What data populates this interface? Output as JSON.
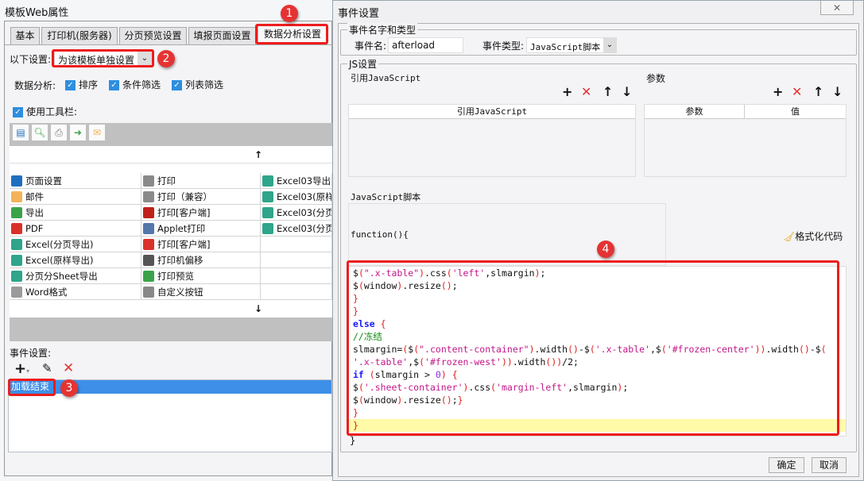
{
  "left_window": {
    "title": "模板Web属性",
    "tabs": [
      "基本",
      "打印机(服务器)",
      "分页预览设置",
      "填报页面设置",
      "数据分析设置"
    ],
    "active_tab": 4,
    "settings_label": "以下设置:",
    "settings_value": "为该模板单独设置",
    "analysis_label": "数据分析:",
    "analysis_options": [
      {
        "label": "排序",
        "checked": true
      },
      {
        "label": "条件筛选",
        "checked": true
      },
      {
        "label": "列表筛选",
        "checked": true
      }
    ],
    "use_toolbar": {
      "label": "使用工具栏:",
      "checked": true
    },
    "toolbar_icons": [
      "page-setup-icon",
      "print-preview-icon",
      "print-icon",
      "export-icon",
      "email-icon"
    ],
    "grid_columns": [
      [
        {
          "label": "页面设置",
          "icon": "page-setup-icon",
          "color": "#1f6fc0"
        },
        {
          "label": "邮件",
          "icon": "email-icon",
          "color": "#f3b35a"
        },
        {
          "label": "导出",
          "icon": "export-icon",
          "color": "#3aa34a"
        },
        {
          "label": "PDF",
          "icon": "pdf-icon",
          "color": "#d9322a"
        },
        {
          "label": "Excel(分页导出)",
          "icon": "excel-icon",
          "color": "#2fa58a"
        },
        {
          "label": "Excel(原样导出)",
          "icon": "excel-icon",
          "color": "#2fa58a"
        },
        {
          "label": "分页分Sheet导出",
          "icon": "excel-icon",
          "color": "#2fa58a"
        },
        {
          "label": "Word格式",
          "icon": "word-icon",
          "color": "#9a9a9a"
        }
      ],
      [
        {
          "label": "打印",
          "icon": "print-icon",
          "color": "#8a8a8a"
        },
        {
          "label": "打印（兼容）",
          "icon": "print-icon",
          "color": "#8a8a8a"
        },
        {
          "label": "打印[客户端]",
          "icon": "flash-print-icon",
          "color": "#c0201a"
        },
        {
          "label": "Applet打印",
          "icon": "java-icon",
          "color": "#5577aa"
        },
        {
          "label": "打印[客户端]",
          "icon": "pdf-print-icon",
          "color": "#d9322a"
        },
        {
          "label": "打印机偏移",
          "icon": "move-icon",
          "color": "#555555"
        },
        {
          "label": "打印预览",
          "icon": "print-preview-icon",
          "color": "#3aa34a"
        },
        {
          "label": "自定义按钮",
          "icon": "gear-icon",
          "color": "#888888"
        }
      ],
      [
        {
          "label": "Excel03导出",
          "icon": "excel-icon",
          "color": "#2fa58a"
        },
        {
          "label": "Excel03(原样",
          "icon": "excel-icon",
          "color": "#2fa58a"
        },
        {
          "label": "Excel03(分页",
          "icon": "excel-icon",
          "color": "#2fa58a"
        },
        {
          "label": "Excel03(分页",
          "icon": "excel-icon",
          "color": "#2fa58a"
        }
      ]
    ],
    "event_label": "事件设置:",
    "events": [
      "加载结束"
    ],
    "selected_color": "#3d8fe8"
  },
  "annotations": [
    "1",
    "2",
    "3",
    "4"
  ],
  "dialog": {
    "title": "事件设置",
    "name_type_group": "事件名字和类型",
    "event_name_label": "事件名:",
    "event_name_value": "afterload",
    "event_type_label": "事件类型:",
    "event_type_value": "JavaScript脚本",
    "js_group": "JS设置",
    "ref_js_label": "引用JavaScript",
    "ref_js_header": "引用JavaScript",
    "params_label": "参数",
    "params_headers": [
      "参数",
      "值"
    ],
    "script_label": "JavaScript脚本",
    "function_header": "function(){",
    "format_code": "格式化代码",
    "code_lines": [
      [
        [
          "$",
          "plain"
        ],
        [
          "(",
          "paren"
        ],
        [
          "\".x-table\"",
          "str"
        ],
        [
          ")",
          "paren"
        ],
        [
          ".css",
          "plain"
        ],
        [
          "(",
          "paren"
        ],
        [
          "'left'",
          "str"
        ],
        [
          ",slmargin",
          "plain"
        ],
        [
          ")",
          "paren"
        ],
        [
          ";",
          "plain"
        ]
      ],
      [
        [
          "$",
          "plain"
        ],
        [
          "(",
          "paren"
        ],
        [
          "window",
          "plain"
        ],
        [
          ")",
          "paren"
        ],
        [
          ".resize",
          "plain"
        ],
        [
          "()",
          "paren"
        ],
        [
          ";",
          "plain"
        ]
      ],
      [
        [
          "}",
          "paren"
        ]
      ],
      [
        [
          "}",
          "paren"
        ]
      ],
      [
        [
          "else ",
          "kw"
        ],
        [
          "{",
          "paren"
        ]
      ],
      [
        [
          "//冻结",
          "com"
        ]
      ],
      [
        [
          "slmargin=",
          "plain"
        ],
        [
          "(",
          "paren"
        ],
        [
          "$",
          "plain"
        ],
        [
          "(",
          "paren"
        ],
        [
          "\".content-container\"",
          "str"
        ],
        [
          ")",
          "paren"
        ],
        [
          ".width",
          "plain"
        ],
        [
          "()",
          "paren"
        ],
        [
          "-$",
          "plain"
        ],
        [
          "(",
          "paren"
        ],
        [
          "'.x-table'",
          "str"
        ],
        [
          ",$",
          "plain"
        ],
        [
          "(",
          "paren"
        ],
        [
          "'#frozen-center'",
          "str"
        ],
        [
          "))",
          "paren"
        ],
        [
          ".width",
          "plain"
        ],
        [
          "()",
          "paren"
        ],
        [
          "-$",
          "plain"
        ],
        [
          "(",
          "paren"
        ]
      ],
      [
        [
          "'.x-table'",
          "str"
        ],
        [
          ",$",
          "plain"
        ],
        [
          "(",
          "paren"
        ],
        [
          "'#frozen-west'",
          "str"
        ],
        [
          "))",
          "paren"
        ],
        [
          ".width",
          "plain"
        ],
        [
          "())",
          "paren"
        ],
        [
          "/2;",
          "plain"
        ]
      ],
      [
        [
          "if ",
          "kw"
        ],
        [
          "(",
          "paren"
        ],
        [
          "slmargin ",
          "plain"
        ],
        [
          "> ",
          "plain"
        ],
        [
          "0",
          "num"
        ],
        [
          ") ",
          "paren"
        ],
        [
          "{",
          "paren"
        ]
      ],
      [
        [
          "$",
          "plain"
        ],
        [
          "(",
          "paren"
        ],
        [
          "'.sheet-container'",
          "str"
        ],
        [
          ")",
          "paren"
        ],
        [
          ".css",
          "plain"
        ],
        [
          "(",
          "paren"
        ],
        [
          "'margin-left'",
          "str"
        ],
        [
          ",slmargin",
          "plain"
        ],
        [
          ")",
          "paren"
        ],
        [
          ";",
          "plain"
        ]
      ],
      [
        [
          "$",
          "plain"
        ],
        [
          "(",
          "paren"
        ],
        [
          "window",
          "plain"
        ],
        [
          ")",
          "paren"
        ],
        [
          ".resize",
          "plain"
        ],
        [
          "()",
          "paren"
        ],
        [
          ";",
          "plain"
        ],
        [
          "}",
          "paren"
        ]
      ],
      [
        [
          "}",
          "paren"
        ]
      ],
      [
        [
          "}",
          "paren"
        ]
      ]
    ],
    "function_footer": "}",
    "ok": "确定",
    "cancel": "取消"
  }
}
